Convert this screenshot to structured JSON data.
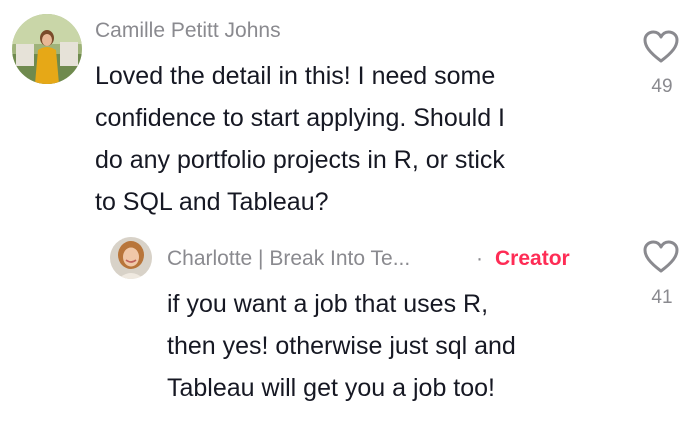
{
  "comment": {
    "author": "Camille Petitt Johns",
    "text_lines": [
      "Loved the detail in this! I need some",
      "confidence to start applying. Should I",
      "do any portfolio projects in R, or stick",
      "to SQL and Tableau?"
    ],
    "like_count": "49",
    "like_icon": "heart-outline-icon"
  },
  "reply": {
    "author": "Charlotte | Break Into Te...",
    "separator": "·",
    "badge": "Creator",
    "text_lines": [
      "if you want a job that uses R,",
      "then yes! otherwise just sql and",
      "Tableau will get you a job too!"
    ],
    "like_count": "41",
    "like_icon": "heart-outline-icon"
  },
  "colors": {
    "text": "#161823",
    "muted": "#8a8a8f",
    "creator_accent": "#fe2c55"
  }
}
